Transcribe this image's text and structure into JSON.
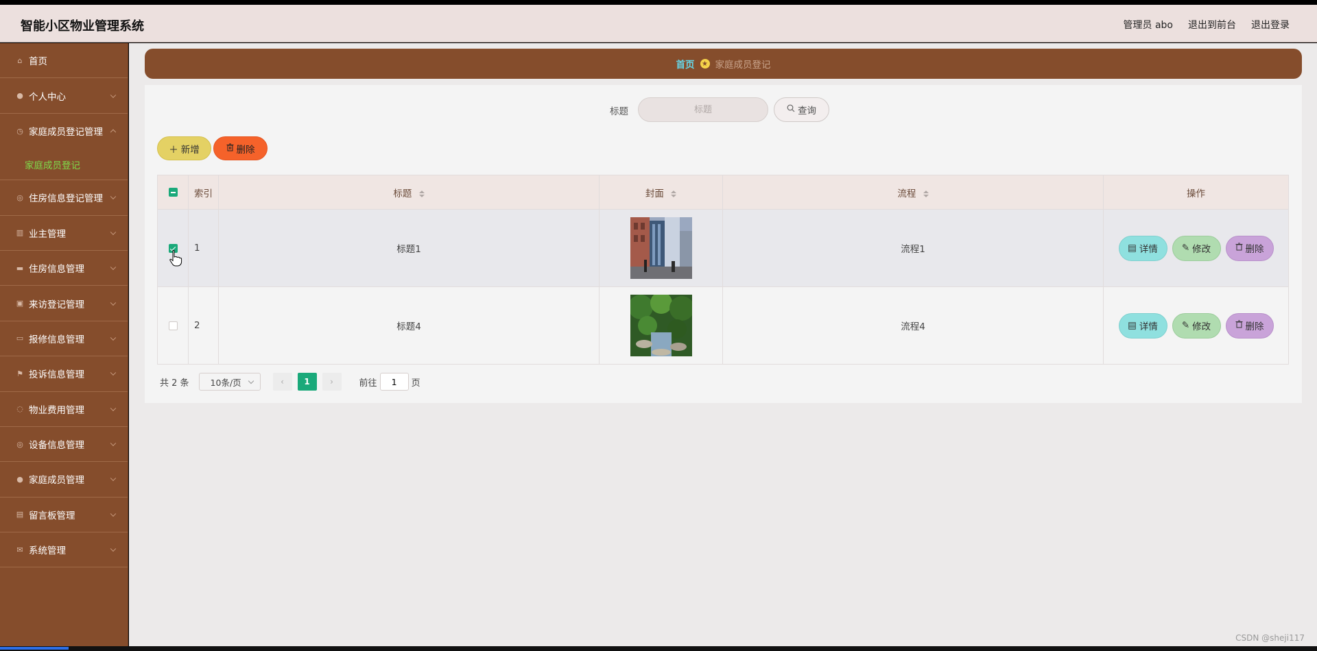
{
  "app": {
    "title": "智能小区物业管理系统"
  },
  "header": {
    "user": "管理员 abo",
    "front": "退出到前台",
    "logout": "退出登录"
  },
  "sidebar": {
    "items": [
      {
        "label": "首页",
        "icon": "home-icon"
      },
      {
        "label": "个人中心",
        "icon": "user-icon"
      },
      {
        "label": "家庭成员登记管理",
        "icon": "clock-icon",
        "open": true
      },
      {
        "label": "住房信息登记管理",
        "icon": "compass-icon"
      },
      {
        "label": "业主管理",
        "icon": "chart-icon"
      },
      {
        "label": "住房信息管理",
        "icon": "briefcase-icon"
      },
      {
        "label": "来访登记管理",
        "icon": "checkbox-icon"
      },
      {
        "label": "报修信息管理",
        "icon": "ticket-icon"
      },
      {
        "label": "投诉信息管理",
        "icon": "flag-icon"
      },
      {
        "label": "物业费用管理",
        "icon": "dashed-circle-icon"
      },
      {
        "label": "设备信息管理",
        "icon": "compass-icon"
      },
      {
        "label": "家庭成员管理",
        "icon": "pin-icon"
      },
      {
        "label": "留言板管理",
        "icon": "document-icon"
      },
      {
        "label": "系统管理",
        "icon": "mail-icon"
      }
    ],
    "subitem": "家庭成员登记"
  },
  "breadcrumb": {
    "home": "首页",
    "current": "家庭成员登记"
  },
  "search": {
    "label": "标题",
    "placeholder": "标题",
    "button": "查询"
  },
  "actions": {
    "add": "新增",
    "delete": "删除"
  },
  "table": {
    "headers": {
      "index": "索引",
      "title": "标题",
      "cover": "封面",
      "flow": "流程",
      "ops": "操作"
    },
    "rows": [
      {
        "index": "1",
        "title": "标题1",
        "flow": "流程1",
        "checked": true
      },
      {
        "index": "2",
        "title": "标题4",
        "flow": "流程4",
        "checked": false
      }
    ],
    "ops": {
      "detail": "详情",
      "edit": "修改",
      "delete": "删除"
    }
  },
  "pager": {
    "total": "共 2 条",
    "size": "10条/页",
    "current": "1",
    "goto_prefix": "前往",
    "goto_value": "1",
    "goto_suffix": "页"
  },
  "watermark": "CSDN @sheji117",
  "colors": {
    "sidebar": "#854d2c",
    "accent": "#1aa97a",
    "header": "#ece0de"
  }
}
